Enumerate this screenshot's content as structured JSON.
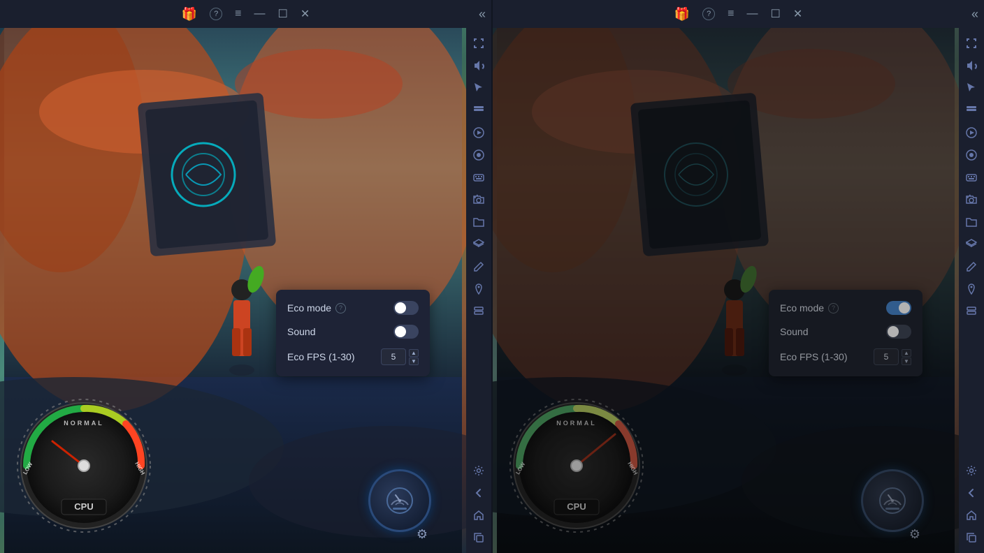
{
  "titlebar": {
    "panel1": {
      "gift_icon": "🎁",
      "help_icon": "?",
      "menu_icon": "≡",
      "minimize_icon": "—",
      "maximize_icon": "☐",
      "close_icon": "✕",
      "back_icon": "«"
    },
    "panel2": {
      "gift_icon": "🎁",
      "help_icon": "?",
      "menu_icon": "≡",
      "minimize_icon": "—",
      "maximize_icon": "☐",
      "close_icon": "✕",
      "back_icon": "«"
    }
  },
  "panel1": {
    "eco_popup": {
      "eco_mode_label": "Eco mode",
      "eco_mode_toggle": "off",
      "sound_label": "Sound",
      "sound_toggle": "off",
      "fps_label": "Eco FPS (1-30)",
      "fps_value": "5"
    },
    "gauge": {
      "normal_text": "NORMAL",
      "low_text": "LOW",
      "high_text": "HIGH",
      "cpu_label": "CPU"
    }
  },
  "panel2": {
    "eco_popup": {
      "eco_mode_label": "Eco mode",
      "eco_mode_toggle": "on",
      "sound_label": "Sound",
      "sound_toggle": "off",
      "fps_label": "Eco FPS (1-30)",
      "fps_value": "5"
    },
    "gauge": {
      "normal_text": "NORMAL",
      "low_text": "LOW",
      "high_text": "HIGH",
      "cpu_label": "CPU"
    }
  },
  "sidebar": {
    "icons": [
      "fullscreen",
      "volume",
      "cursor",
      "toolbar",
      "play",
      "record",
      "keyboard",
      "screenshot",
      "folder",
      "layers",
      "edit",
      "location",
      "stack",
      "gear",
      "back",
      "home",
      "copy"
    ]
  }
}
